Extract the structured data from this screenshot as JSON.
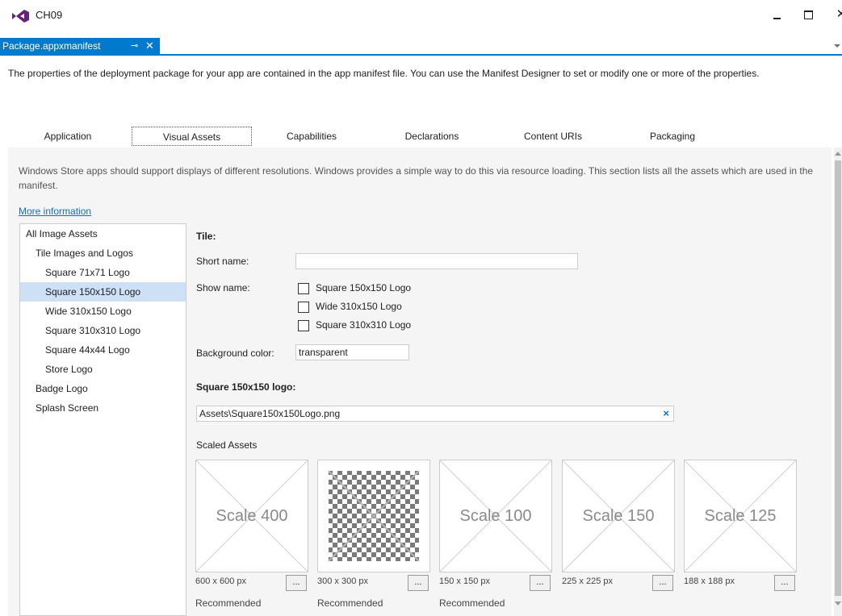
{
  "window": {
    "title": "CH09"
  },
  "document_tab": {
    "label": "Package.appxmanifest",
    "pin_icon": "pin-icon",
    "close_glyph": "✕"
  },
  "description": "The properties of the deployment package for your app are contained in the app manifest file. You can use the Manifest Designer to set or modify one or more of the properties.",
  "section_tabs": [
    {
      "label": "Application"
    },
    {
      "label": "Visual Assets"
    },
    {
      "label": "Capabilities"
    },
    {
      "label": "Declarations"
    },
    {
      "label": "Content URIs"
    },
    {
      "label": "Packaging"
    }
  ],
  "active_section": "Visual Assets",
  "panel": {
    "description": "Windows Store apps should support displays of different resolutions. Windows provides a simple way to do this via resource loading. This section lists all the assets which are used in the manifest.",
    "more_info": "More information"
  },
  "tree": [
    {
      "label": "All Image Assets",
      "level": 0
    },
    {
      "label": "Tile Images and Logos",
      "level": 1
    },
    {
      "label": "Square 71x71 Logo",
      "level": 2
    },
    {
      "label": "Square 150x150 Logo",
      "level": 2,
      "selected": true
    },
    {
      "label": "Wide 310x150 Logo",
      "level": 2
    },
    {
      "label": "Square 310x310 Logo",
      "level": 2
    },
    {
      "label": "Square 44x44 Logo",
      "level": 2
    },
    {
      "label": "Store Logo",
      "level": 2
    },
    {
      "label": "Badge Logo",
      "level": 1
    },
    {
      "label": "Splash Screen",
      "level": 1
    }
  ],
  "tile": {
    "heading": "Tile:",
    "short_name_label": "Short name:",
    "short_name_value": "",
    "show_name_label": "Show name:",
    "show_name_options": [
      {
        "label": "Square 150x150 Logo",
        "checked": false
      },
      {
        "label": "Wide 310x150 Logo",
        "checked": false
      },
      {
        "label": "Square 310x310 Logo",
        "checked": false
      }
    ],
    "background_color_label": "Background color:",
    "background_color_value": "transparent"
  },
  "logo": {
    "heading": "Square 150x150 logo:",
    "path": "Assets\\Square150x150Logo.png",
    "clear_glyph": "×"
  },
  "scaled_assets": {
    "heading": "Scaled Assets",
    "browse_label": "...",
    "items": [
      {
        "placeholder": "Scale 400",
        "size": "600 x 600 px",
        "note": "Recommended",
        "has_image": false
      },
      {
        "placeholder": "",
        "size": "300 x 300 px",
        "note": "Recommended",
        "has_image": true
      },
      {
        "placeholder": "Scale 100",
        "size": "150 x 150 px",
        "note": "Recommended",
        "has_image": false
      },
      {
        "placeholder": "Scale 150",
        "size": "225 x 225 px",
        "note": "",
        "has_image": false
      },
      {
        "placeholder": "Scale 125",
        "size": "188 x 188 px",
        "note": "",
        "has_image": false
      }
    ]
  },
  "colors": {
    "accent": "#007acc",
    "link": "#0e70c0",
    "selection": "#cde0f5",
    "panel_bg": "#f5f5f5"
  }
}
